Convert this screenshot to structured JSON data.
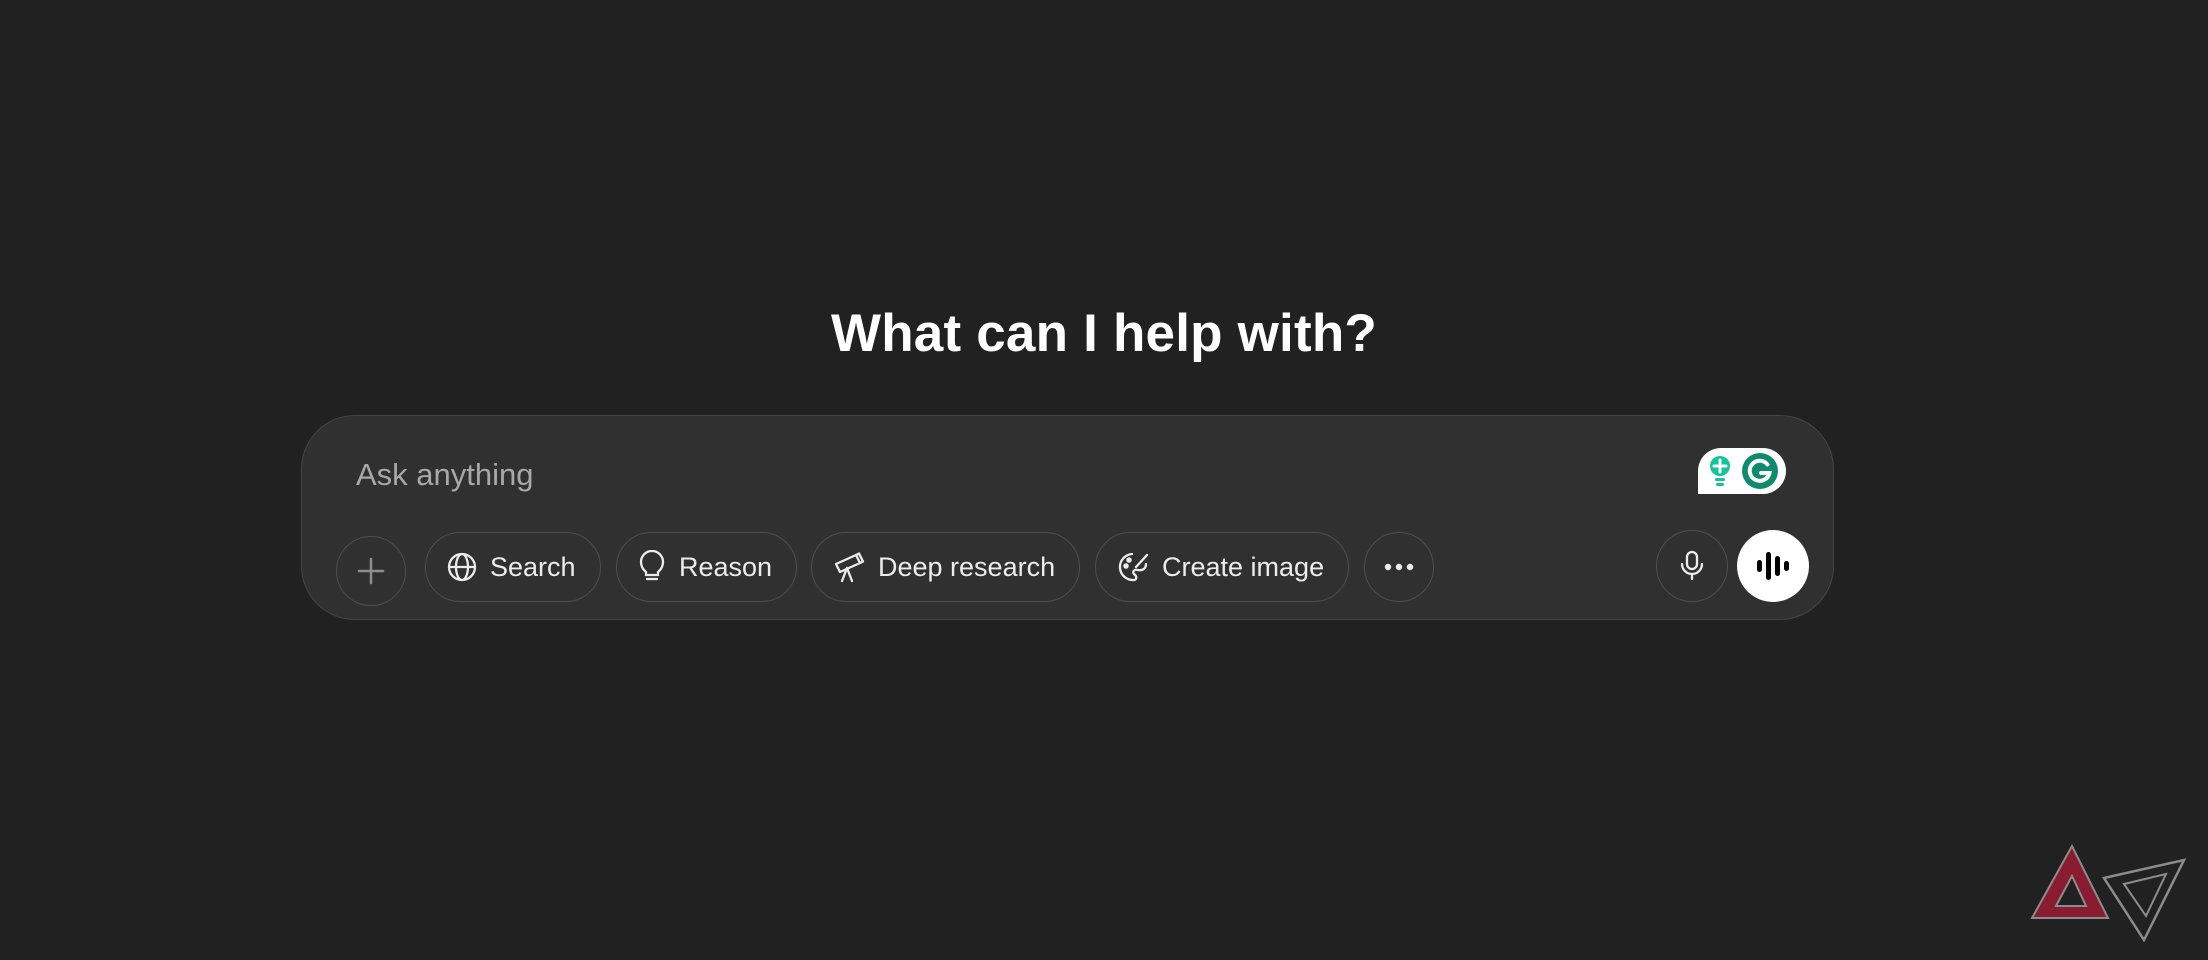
{
  "headline": "What can I help with?",
  "composer": {
    "placeholder": "Ask anything",
    "attach_icon": "plus-icon",
    "tools": [
      {
        "label": "Search",
        "icon": "globe-icon"
      },
      {
        "label": "Reason",
        "icon": "lightbulb-icon"
      },
      {
        "label": "Deep research",
        "icon": "telescope-icon"
      },
      {
        "label": "Create image",
        "icon": "palette-icon"
      }
    ],
    "more_icon": "ellipsis-icon",
    "dictate_icon": "microphone-icon",
    "voice_icon": "voice-waveform-icon"
  },
  "extension": {
    "name": "Grammarly",
    "colors": {
      "brand": "#15c39a",
      "dark_green": "#0e8a6d"
    }
  },
  "watermark": {
    "name": "Android Police logo",
    "colors": {
      "maroon": "#8a1c32",
      "outline": "#8c8c8c"
    }
  },
  "colors": {
    "background": "#212121",
    "composer": "#303030",
    "border": "#4e4e4e",
    "text": "#ececec",
    "placeholder": "#a8a8a8"
  }
}
